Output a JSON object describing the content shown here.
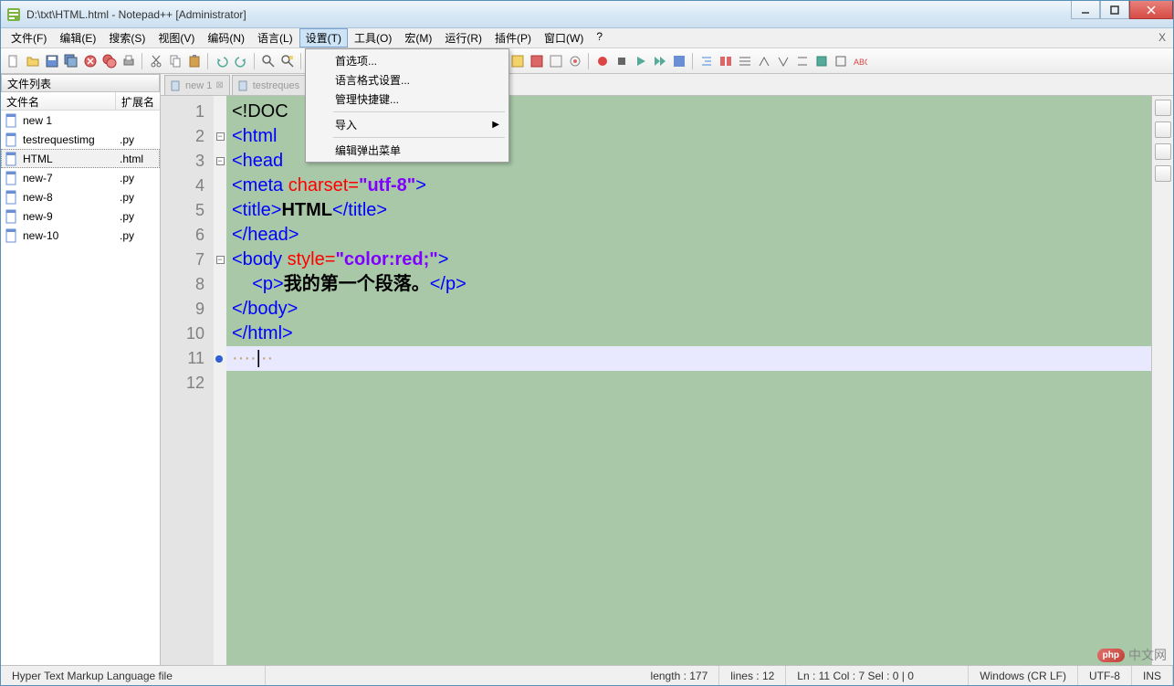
{
  "title": "D:\\txt\\HTML.html - Notepad++  [Administrator]",
  "menubar": [
    "文件(F)",
    "编辑(E)",
    "搜索(S)",
    "视图(V)",
    "编码(N)",
    "语言(L)",
    "设置(T)",
    "工具(O)",
    "宏(M)",
    "运行(R)",
    "插件(P)",
    "窗口(W)",
    "?"
  ],
  "active_menu_index": 6,
  "dropdown": {
    "items": [
      {
        "label": "首选项...",
        "sep": false
      },
      {
        "label": "语言格式设置...",
        "sep": false
      },
      {
        "label": "管理快捷键...",
        "sep": true
      },
      {
        "label": "导入",
        "sep": true,
        "submenu": true
      },
      {
        "label": "编辑弹出菜单",
        "sep": false
      }
    ]
  },
  "side_panel": {
    "title": "文件列表",
    "col_name": "文件名",
    "col_ext": "扩展名",
    "files": [
      {
        "name": "new 1",
        "ext": ""
      },
      {
        "name": "testrequestimg",
        "ext": ".py"
      },
      {
        "name": "HTML",
        "ext": ".html",
        "selected": true
      },
      {
        "name": "new-7",
        "ext": ".py"
      },
      {
        "name": "new-8",
        "ext": ".py"
      },
      {
        "name": "new-9",
        "ext": ".py"
      },
      {
        "name": "new-10",
        "ext": ".py"
      }
    ]
  },
  "tabs": [
    {
      "label": "new 1",
      "close": true
    },
    {
      "label": "testreques",
      "close": false
    }
  ],
  "code_lines": [
    {
      "n": 1,
      "fold": "",
      "html": "<span class='c-doc'>&lt;!DOC</span>"
    },
    {
      "n": 2,
      "fold": "-",
      "html": "<span class='c-tag'>&lt;html</span>"
    },
    {
      "n": 3,
      "fold": "-",
      "html": "<span class='c-tag'>&lt;head</span>"
    },
    {
      "n": 4,
      "fold": "",
      "html": "<span class='c-tag'>&lt;meta</span> <span class='c-attr'>charset=</span><span class='c-str'>\"utf-8\"</span><span class='c-tag'>&gt;</span>"
    },
    {
      "n": 5,
      "fold": "",
      "html": "<span class='c-tag'>&lt;title&gt;</span><span class='c-text'>HTML</span><span class='c-tag'>&lt;/title&gt;</span>"
    },
    {
      "n": 6,
      "fold": "",
      "html": "<span class='c-tag'>&lt;/head&gt;</span>"
    },
    {
      "n": 7,
      "fold": "-",
      "html": "<span class='c-tag'>&lt;body</span> <span class='c-attr'>style=</span><span class='c-str'>\"color:red;\"</span><span class='c-tag'>&gt;</span>"
    },
    {
      "n": 8,
      "fold": "",
      "html": "    <span class='c-tag'>&lt;p&gt;</span><span class='c-text'>我的第一个段落。</span><span class='c-tag'>&lt;/p&gt;</span>"
    },
    {
      "n": 9,
      "fold": "",
      "html": "<span class='c-tag'>&lt;/body&gt;</span>"
    },
    {
      "n": 10,
      "fold": "",
      "html": "<span class='c-tag'>&lt;/html&gt;</span>"
    },
    {
      "n": 11,
      "fold": "",
      "current": true,
      "html": "<span class='c-ws'>····</span>|<span class='c-ws'>··</span>"
    },
    {
      "n": 12,
      "fold": "",
      "html": ""
    }
  ],
  "statusbar": {
    "file_type": "Hyper Text Markup Language file",
    "length": "length : 177",
    "lines": "lines : 12",
    "pos": "Ln : 11    Col : 7    Sel : 0 | 0",
    "eol": "Windows (CR LF)",
    "encoding": "UTF-8",
    "mode": "INS"
  },
  "watermark": {
    "badge": "php",
    "text": "中文网"
  }
}
